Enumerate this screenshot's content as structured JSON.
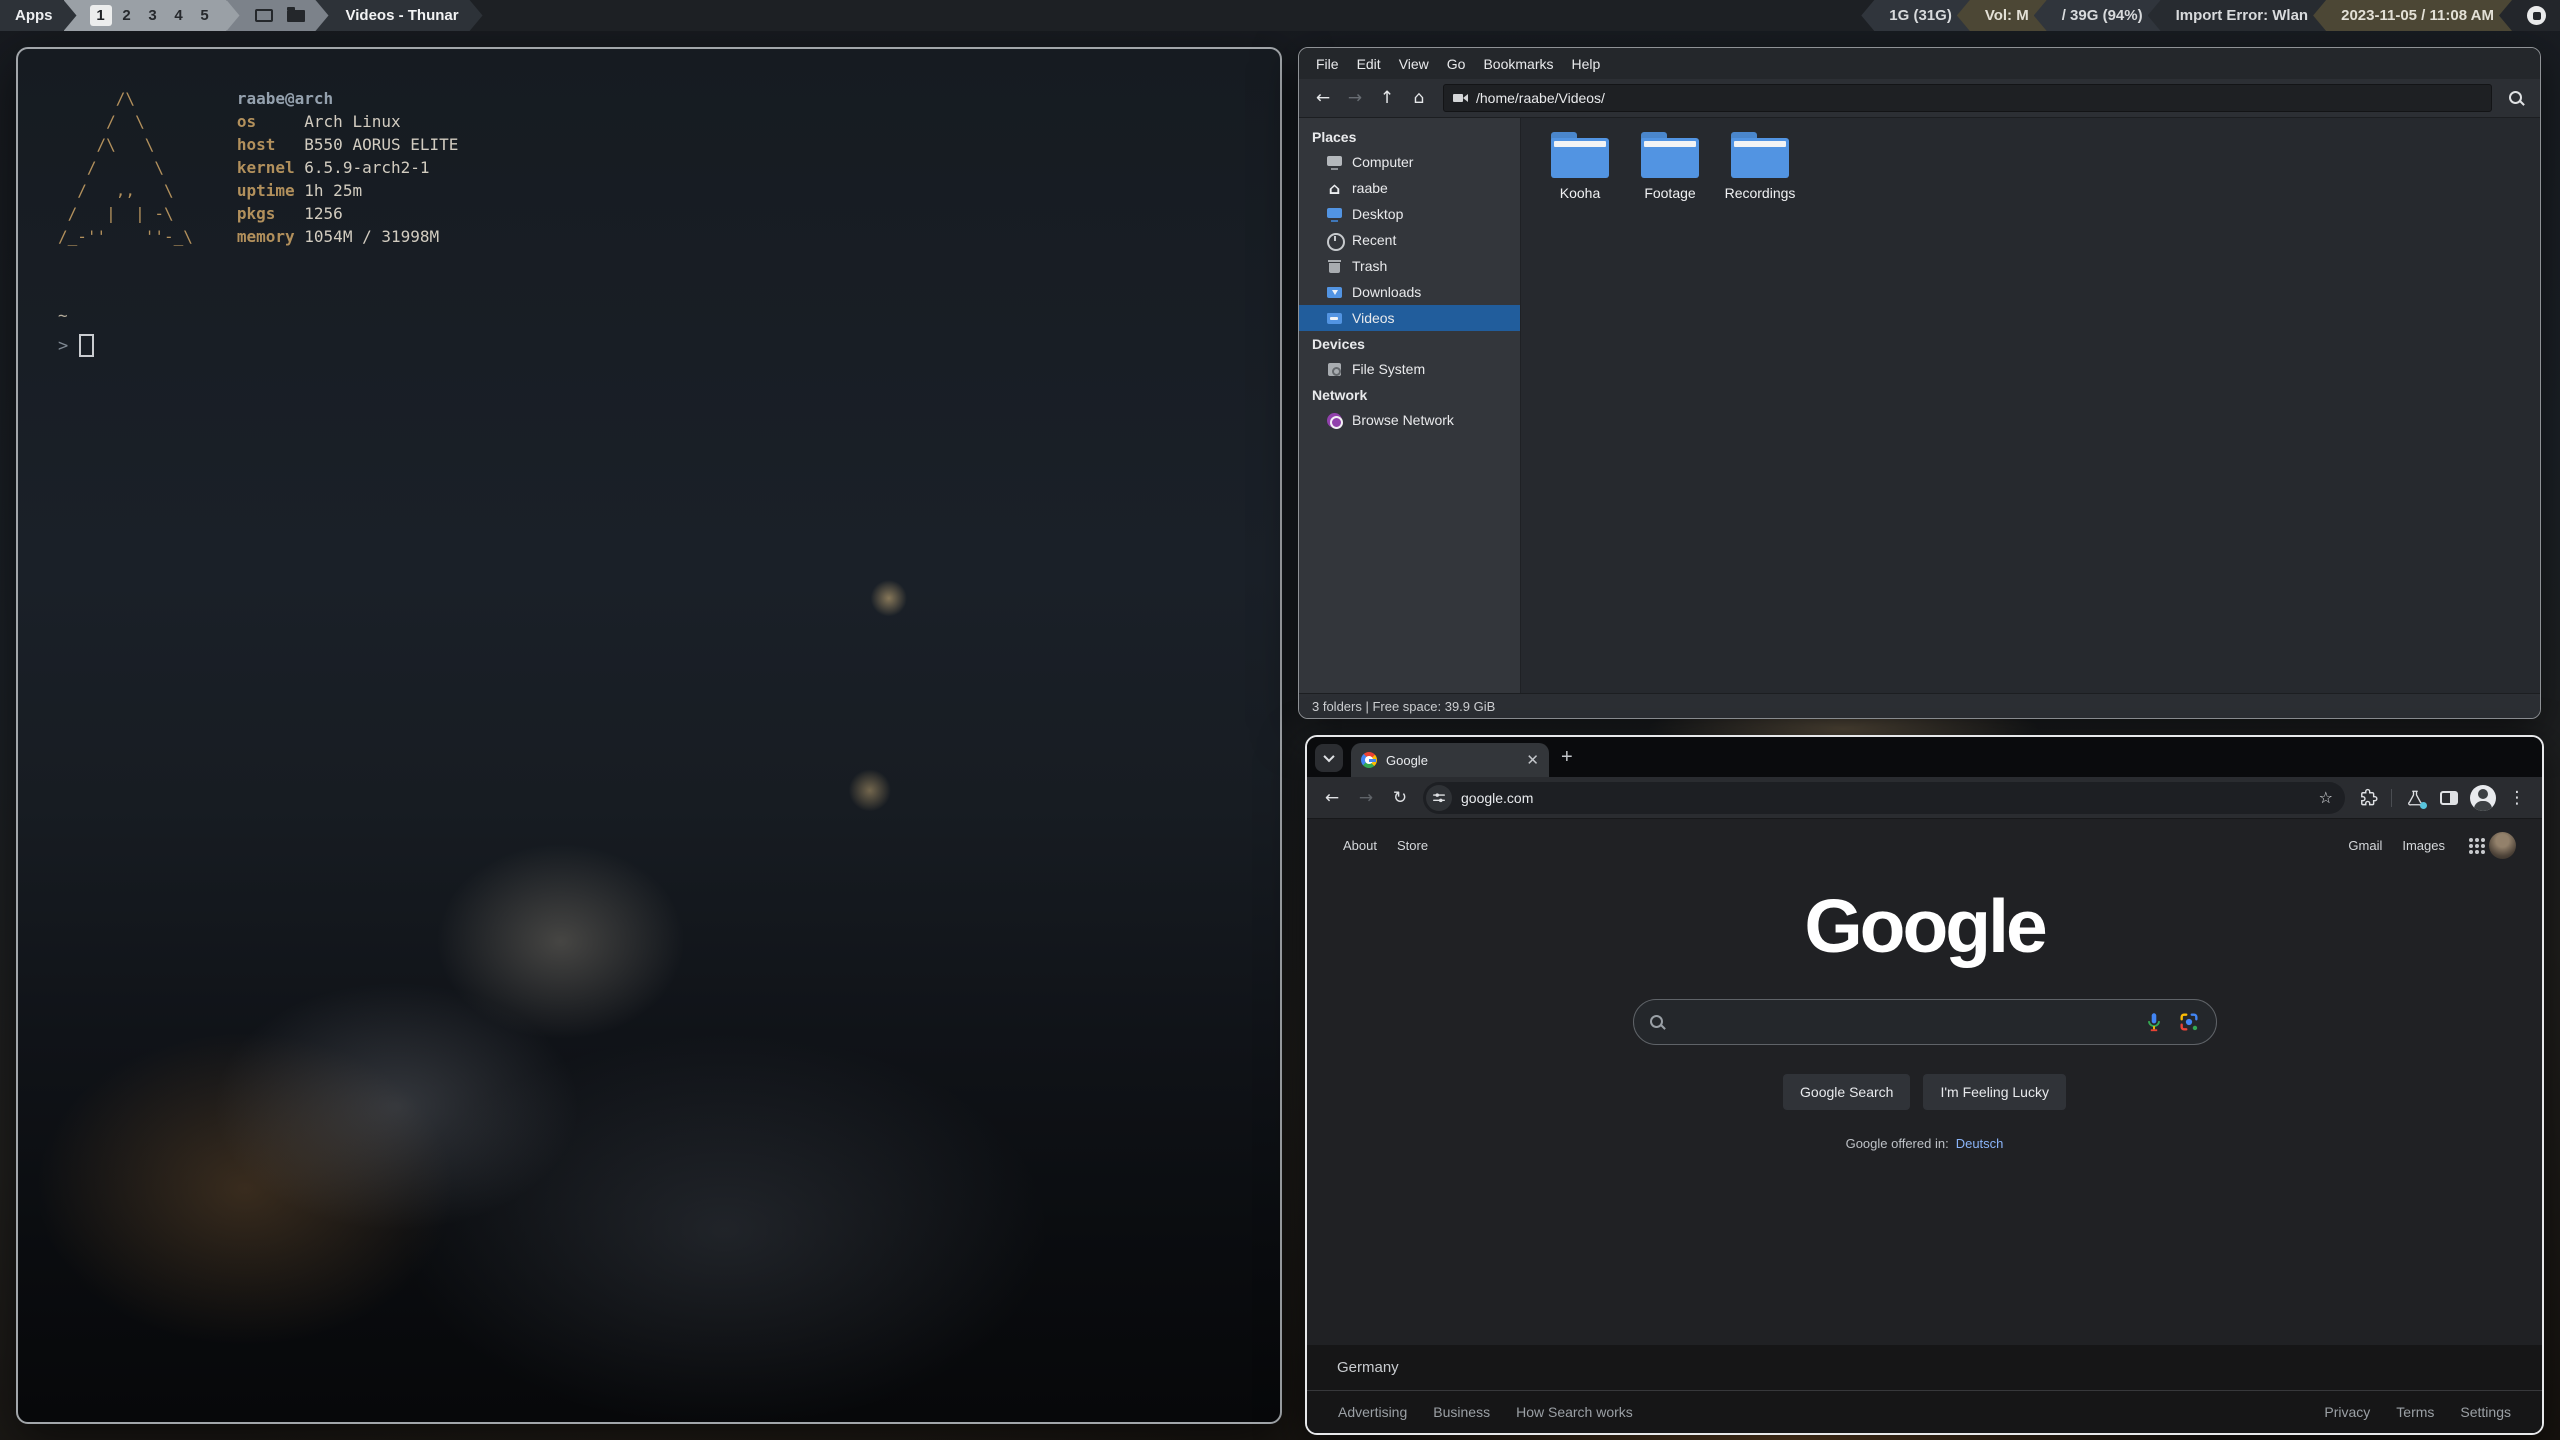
{
  "panel": {
    "apps_label": "Apps",
    "workspaces": [
      "1",
      "2",
      "3",
      "4",
      "5"
    ],
    "active_workspace": "1",
    "window_title": "Videos - Thunar",
    "tray": [
      {
        "label": "1G (31G)"
      },
      {
        "label": "Vol: M"
      },
      {
        "label": "/ 39G (94%)"
      },
      {
        "label": "Import Error: Wlan"
      },
      {
        "label": "2023-11-05 / 11:08 AM"
      }
    ]
  },
  "terminal": {
    "user_host": "raabe@arch",
    "ascii_art": [
      "      /\\",
      "     /  \\",
      "    /\\   \\",
      "   /      \\",
      "  /   ,,   \\",
      " /   |  | -\\",
      "/_-''    ''-_\\"
    ],
    "info": [
      {
        "label": "os",
        "value": "Arch Linux"
      },
      {
        "label": "host",
        "value": "B550 AORUS ELITE"
      },
      {
        "label": "kernel",
        "value": "6.5.9-arch2-1"
      },
      {
        "label": "uptime",
        "value": "1h 25m"
      },
      {
        "label": "pkgs",
        "value": "1256"
      },
      {
        "label": "memory",
        "value": "1054M / 31998M"
      }
    ],
    "cwd": "~",
    "prompt_char": ">"
  },
  "thunar": {
    "menu": [
      "File",
      "Edit",
      "View",
      "Go",
      "Bookmarks",
      "Help"
    ],
    "path": "/home/raabe/Videos/",
    "sections": {
      "places": "Places",
      "devices": "Devices",
      "network": "Network"
    },
    "places": [
      {
        "label": "Computer"
      },
      {
        "label": "raabe"
      },
      {
        "label": "Desktop"
      },
      {
        "label": "Recent"
      },
      {
        "label": "Trash"
      },
      {
        "label": "Downloads"
      },
      {
        "label": "Videos"
      }
    ],
    "devices": [
      {
        "label": "File System"
      }
    ],
    "network": [
      {
        "label": "Browse Network"
      }
    ],
    "folders": [
      {
        "name": "Kooha"
      },
      {
        "name": "Footage"
      },
      {
        "name": "Recordings"
      }
    ],
    "status": "3 folders  |  Free space: 39.9 GiB"
  },
  "chrome": {
    "tab_title": "Google",
    "url": "google.com",
    "page": {
      "about": "About",
      "store": "Store",
      "gmail": "Gmail",
      "images": "Images",
      "logo": "Google",
      "search_button": "Google Search",
      "lucky_button": "I'm Feeling Lucky",
      "offered_in": "Google offered in:",
      "offered_lang": "Deutsch",
      "country": "Germany",
      "footer_links_left": [
        "Advertising",
        "Business",
        "How Search works"
      ],
      "footer_links_right": [
        "Privacy",
        "Terms",
        "Settings"
      ]
    }
  },
  "colors": {
    "selection_blue": "#215d9c",
    "folder_blue": "#5294e2",
    "panel_olive": "#4c4735",
    "link_blue": "#8ab4f8"
  }
}
